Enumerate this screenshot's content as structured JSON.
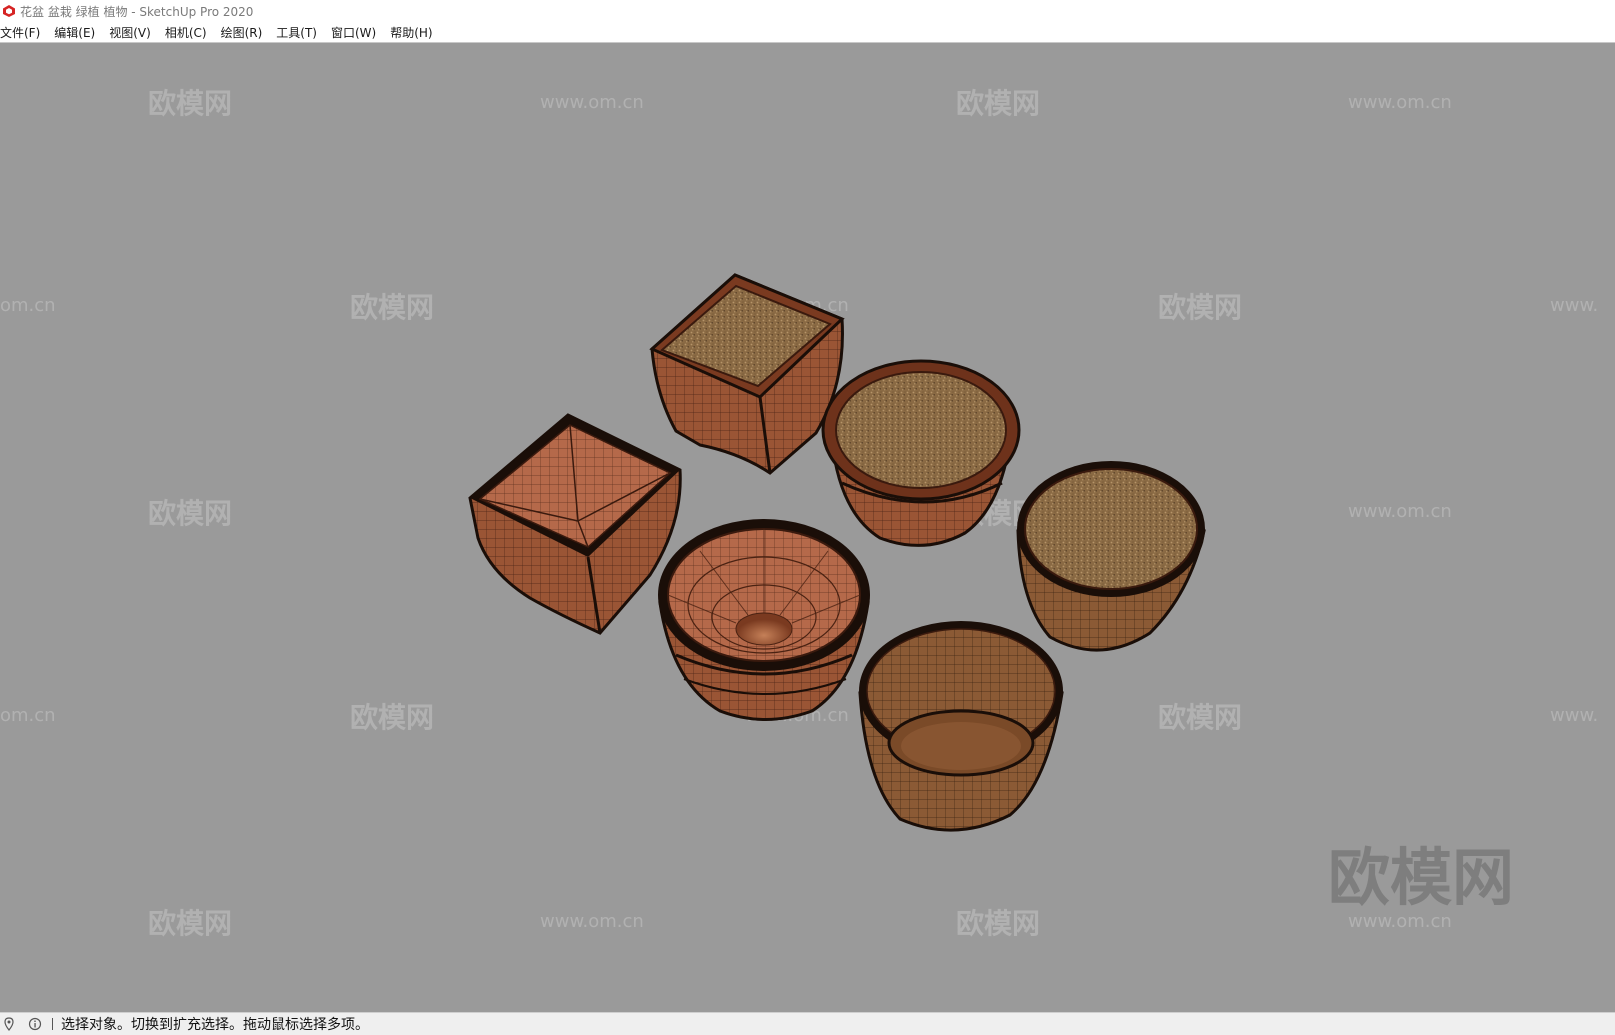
{
  "window": {
    "title": "花盆 盆栽 绿植 植物 - SketchUp Pro 2020",
    "app_icon": "sketchup-logo-icon"
  },
  "menubar": {
    "items": [
      {
        "label": "文件(F)"
      },
      {
        "label": "编辑(E)"
      },
      {
        "label": "视图(V)"
      },
      {
        "label": "相机(C)"
      },
      {
        "label": "绘图(R)"
      },
      {
        "label": "工具(T)"
      },
      {
        "label": "窗口(W)"
      },
      {
        "label": "帮助(H)"
      }
    ]
  },
  "viewport": {
    "background": "#9a9a9a",
    "watermark_cn": "欧模网",
    "watermark_url": "www.om.cn",
    "watermark_url_partial": "om.cn",
    "watermark_url_cut": "www.",
    "objects": [
      "square-pot-with-soil",
      "square-pot-empty",
      "round-pot-with-soil",
      "bowl-pot-empty",
      "cylinder-pot-with-soil",
      "cylinder-pot-empty"
    ]
  },
  "statusbar": {
    "icons": [
      "geolocation-icon",
      "info-icon"
    ],
    "text": "选择对象。切换到扩充选择。拖动鼠标选择多项。"
  },
  "colors": {
    "terracotta": "#9a5535",
    "terracotta_light": "#b86f4f",
    "soil": "#8a6a44",
    "clay_brown": "#8b5a35",
    "pot_outline": "#1a0e08"
  }
}
